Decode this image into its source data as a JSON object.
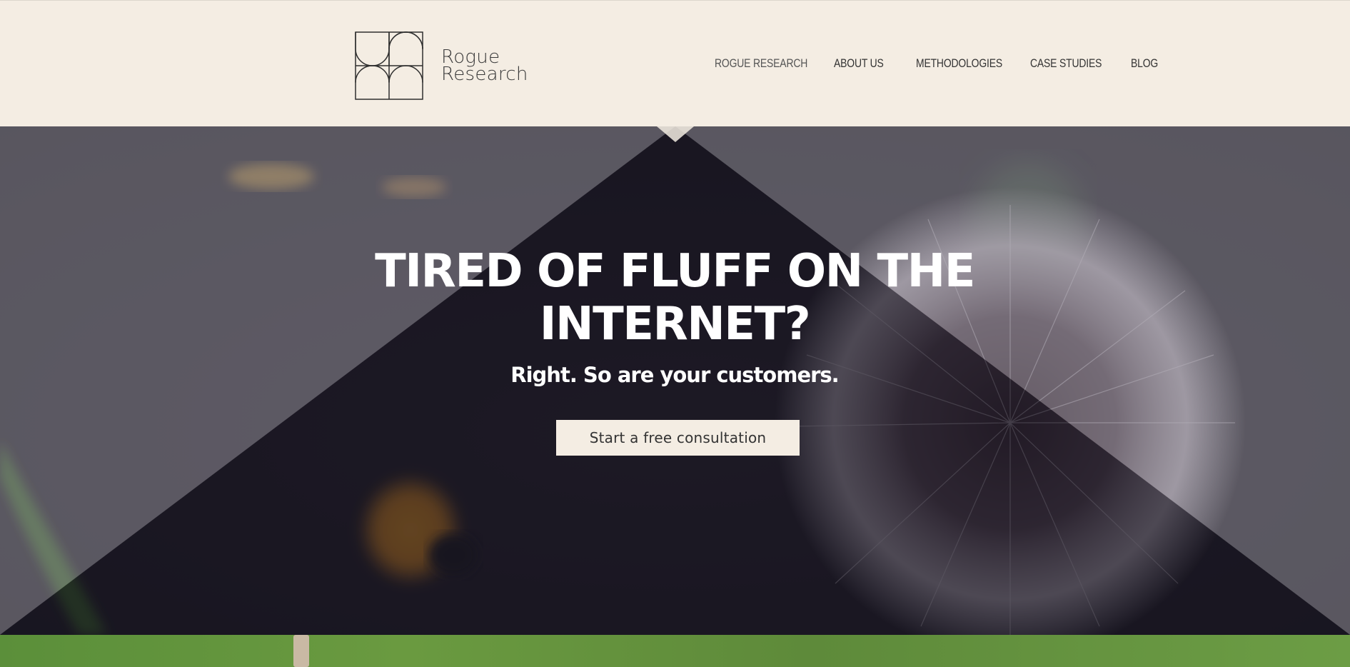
{
  "brand": {
    "name_line1": "Rogue",
    "name_line2": "Research"
  },
  "nav": {
    "items": [
      {
        "label": "ROGUE RESEARCH",
        "active": true
      },
      {
        "label": "ABOUT US"
      },
      {
        "label": "METHODOLOGIES"
      },
      {
        "label": "CASE STUDIES"
      },
      {
        "label": "BLOG"
      }
    ]
  },
  "hero": {
    "title": "TIRED OF FLUFF ON THE INTERNET?",
    "subtitle": "Right. So are your customers.",
    "cta_label": "Start a free consultation",
    "image": "dandelion-photo"
  },
  "colors": {
    "header_bg": "#f4ede3",
    "triangle": "#15131f",
    "text_light": "#ffffff",
    "nav_text": "#333333"
  }
}
